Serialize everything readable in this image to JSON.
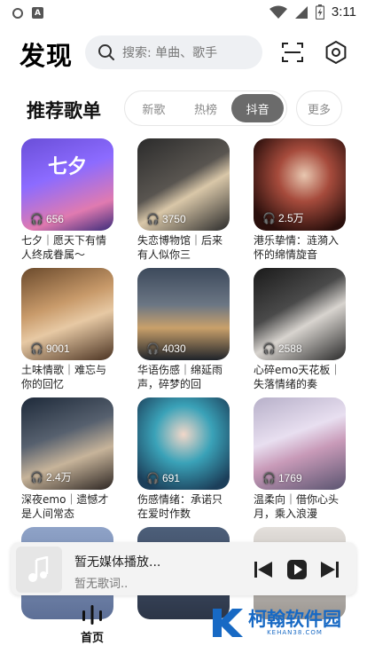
{
  "status_bar": {
    "time": "3:11",
    "left_icons": [
      "circle-notification-icon",
      "a-notification-icon"
    ],
    "right_icons": [
      "wifi-icon",
      "signal-icon",
      "battery-charging-icon"
    ]
  },
  "header": {
    "title": "发现",
    "search_placeholder": "搜索: 单曲、歌手",
    "icons": [
      "search-icon",
      "scan-icon",
      "settings-gear-icon"
    ]
  },
  "section": {
    "title": "推荐歌单",
    "tabs": [
      {
        "label": "新歌",
        "active": false
      },
      {
        "label": "热榜",
        "active": false
      },
      {
        "label": "抖音",
        "active": true
      }
    ],
    "more_label": "更多"
  },
  "playlists": [
    {
      "title": "七夕｜愿天下有情人终成眷属～",
      "count": "656",
      "cover_text": "七夕"
    },
    {
      "title": "失恋博物馆｜后来有人似你三",
      "count": "3750"
    },
    {
      "title": "港乐挚情：涟漪入怀的绵情旋音",
      "count": "2.5万"
    },
    {
      "title": "土味情歌｜难忘与你的回忆",
      "count": "9001"
    },
    {
      "title": "华语伤感｜绵延雨声，碎梦的回",
      "count": "4030"
    },
    {
      "title": "心碎emo天花板｜失落情绪的奏",
      "count": "2588"
    },
    {
      "title": "深夜emo｜遗憾才是人间常态",
      "count": "2.4万"
    },
    {
      "title": "伤感情绪：承诺只在爱时作数",
      "count": "691"
    },
    {
      "title": "温柔向｜借你心头月，乘入浪漫",
      "count": "1769"
    }
  ],
  "player": {
    "title": "暂无媒体播放...",
    "subtitle": "暂无歌词..",
    "controls": [
      "previous-icon",
      "play-icon",
      "next-icon"
    ]
  },
  "bottom_nav": {
    "home_label": "首页"
  },
  "watermark": {
    "name": "柯翰软件园",
    "url": "KEHAN38.COM"
  },
  "colors": {
    "active_tab": "#6b6b6b",
    "search_bg": "#eef0f3",
    "watermark_blue": "#1769c4"
  }
}
